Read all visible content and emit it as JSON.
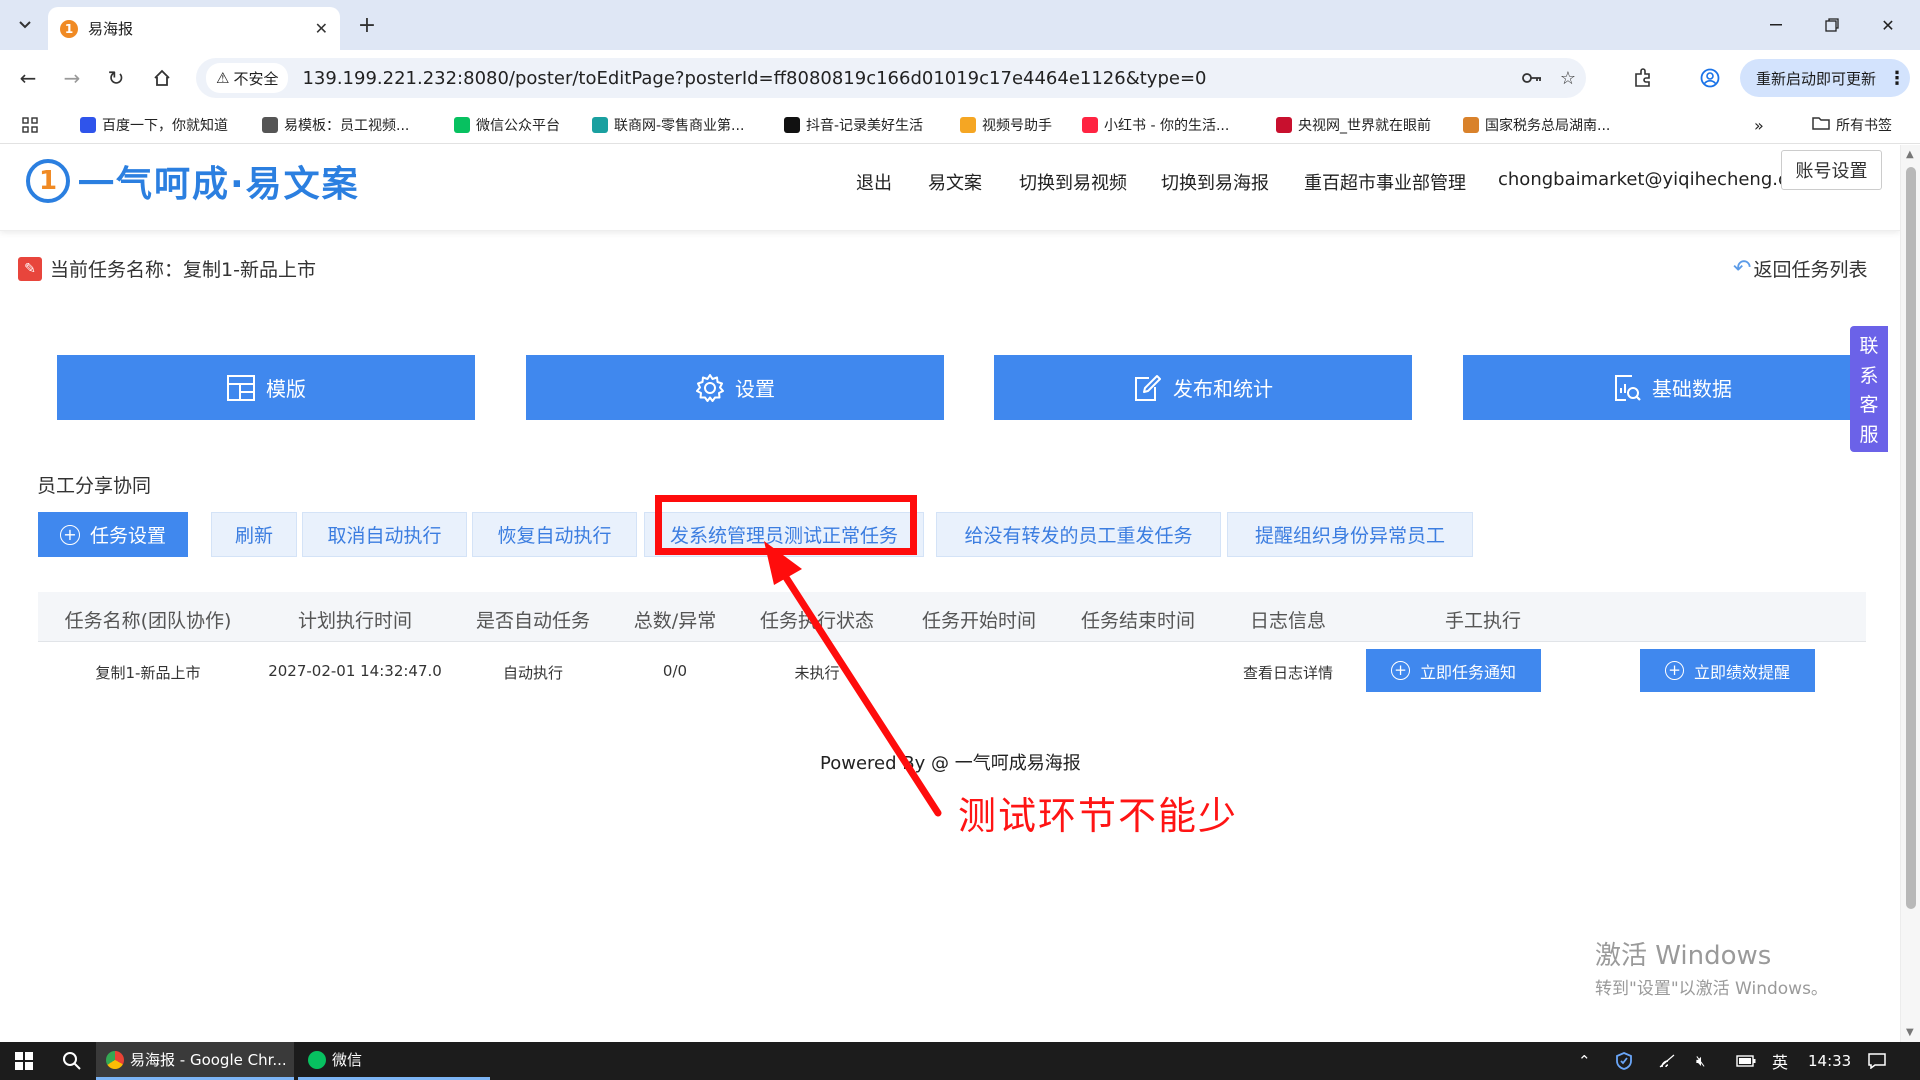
{
  "browser": {
    "tab_title": "易海报",
    "tab_favicon_text": "1",
    "security_chip": "不安全",
    "url": "139.199.221.232:8080/poster/toEditPage?posterId=ff8080819c166d01019c17e4464e1126&type=0",
    "update_button": "重新启动即可更新",
    "bookmarks": [
      {
        "label": "百度一下，你就知道",
        "color": "#2f54eb"
      },
      {
        "label": "易模板：员工视频...",
        "color": "#555555"
      },
      {
        "label": "微信公众平台",
        "color": "#07c160"
      },
      {
        "label": "联商网-零售商业第...",
        "color": "#1aa0a0"
      },
      {
        "label": "抖音-记录美好生活",
        "color": "#111111"
      },
      {
        "label": "视频号助手",
        "color": "#f5a623"
      },
      {
        "label": "小红书 - 你的生活...",
        "color": "#ff2442"
      },
      {
        "label": "央视网_世界就在眼前",
        "color": "#c8102e"
      },
      {
        "label": "国家税务总局湖南...",
        "color": "#d9822b"
      }
    ],
    "bookmarks_overflow": "»",
    "all_bookmarks": "所有书签"
  },
  "site": {
    "logo_text": "一气呵成·易文案",
    "logo_mark": "1",
    "nav": [
      "退出",
      "易文案",
      "切换到易视频",
      "切换到易海报",
      "重百超市事业部管理",
      "chongbaimarket@yiqihecheng.cc"
    ],
    "account_button": "账号设置",
    "current_task_label": "当前任务名称：复制1-新品上市",
    "back_link": "返回任务列表",
    "main_buttons": [
      "模版",
      "设置",
      "发布和统计",
      "基础数据"
    ],
    "side_service": [
      "联",
      "系",
      "客",
      "服"
    ],
    "section_title": "员工分享协同",
    "action_buttons": [
      "任务设置",
      "刷新",
      "取消自动执行",
      "恢复自动执行",
      "发系统管理员测试正常任务",
      "给没有转发的员工重发任务",
      "提醒组织身份异常员工"
    ],
    "table_headers": [
      "任务名称(团队协作)",
      "计划执行时间",
      "是否自动任务",
      "总数/异常",
      "任务执行状态",
      "任务开始时间",
      "任务结束时间",
      "日志信息",
      "手工执行"
    ],
    "table_rows": [
      {
        "name": "复制1-新品上市",
        "planned_time": "2027-02-01 14:32:47.0",
        "auto": "自动执行",
        "total_abnormal": "0/0",
        "status": "未执行",
        "start_time": "",
        "end_time": "",
        "log": "查看日志详情",
        "btn_notify": "立即任务通知",
        "btn_remind": "立即绩效提醒"
      }
    ],
    "powered_by": "Powered By @ 一气呵成易海报"
  },
  "annotation": {
    "text": "测试环节不能少",
    "color": "#ff1414"
  },
  "watermark": {
    "line1": "激活 Windows",
    "line2": "转到\"设置\"以激活 Windows。"
  },
  "taskbar": {
    "apps": [
      "易海报 - Google Chr...",
      "微信"
    ],
    "ime": "英",
    "time": "14:33"
  },
  "colors": {
    "primary_button": "#4088ee",
    "light_button_bg": "#e9f1fc",
    "side_service": "#6b62e8"
  }
}
